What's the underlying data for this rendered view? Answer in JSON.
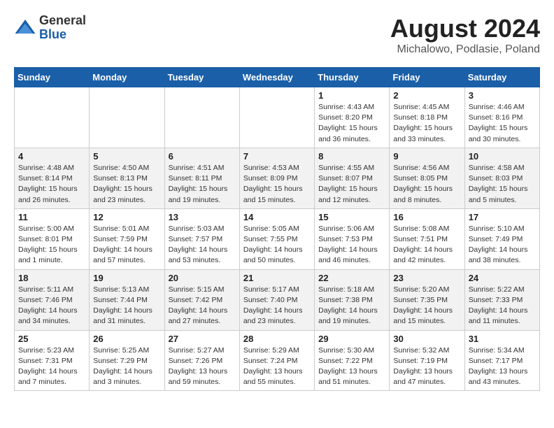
{
  "logo": {
    "general": "General",
    "blue": "Blue"
  },
  "title": {
    "month": "August 2024",
    "location": "Michalowo, Podlasie, Poland"
  },
  "weekdays": [
    "Sunday",
    "Monday",
    "Tuesday",
    "Wednesday",
    "Thursday",
    "Friday",
    "Saturday"
  ],
  "weeks": [
    [
      {
        "day": "",
        "info": ""
      },
      {
        "day": "",
        "info": ""
      },
      {
        "day": "",
        "info": ""
      },
      {
        "day": "",
        "info": ""
      },
      {
        "day": "1",
        "info": "Sunrise: 4:43 AM\nSunset: 8:20 PM\nDaylight: 15 hours\nand 36 minutes."
      },
      {
        "day": "2",
        "info": "Sunrise: 4:45 AM\nSunset: 8:18 PM\nDaylight: 15 hours\nand 33 minutes."
      },
      {
        "day": "3",
        "info": "Sunrise: 4:46 AM\nSunset: 8:16 PM\nDaylight: 15 hours\nand 30 minutes."
      }
    ],
    [
      {
        "day": "4",
        "info": "Sunrise: 4:48 AM\nSunset: 8:14 PM\nDaylight: 15 hours\nand 26 minutes."
      },
      {
        "day": "5",
        "info": "Sunrise: 4:50 AM\nSunset: 8:13 PM\nDaylight: 15 hours\nand 23 minutes."
      },
      {
        "day": "6",
        "info": "Sunrise: 4:51 AM\nSunset: 8:11 PM\nDaylight: 15 hours\nand 19 minutes."
      },
      {
        "day": "7",
        "info": "Sunrise: 4:53 AM\nSunset: 8:09 PM\nDaylight: 15 hours\nand 15 minutes."
      },
      {
        "day": "8",
        "info": "Sunrise: 4:55 AM\nSunset: 8:07 PM\nDaylight: 15 hours\nand 12 minutes."
      },
      {
        "day": "9",
        "info": "Sunrise: 4:56 AM\nSunset: 8:05 PM\nDaylight: 15 hours\nand 8 minutes."
      },
      {
        "day": "10",
        "info": "Sunrise: 4:58 AM\nSunset: 8:03 PM\nDaylight: 15 hours\nand 5 minutes."
      }
    ],
    [
      {
        "day": "11",
        "info": "Sunrise: 5:00 AM\nSunset: 8:01 PM\nDaylight: 15 hours\nand 1 minute."
      },
      {
        "day": "12",
        "info": "Sunrise: 5:01 AM\nSunset: 7:59 PM\nDaylight: 14 hours\nand 57 minutes."
      },
      {
        "day": "13",
        "info": "Sunrise: 5:03 AM\nSunset: 7:57 PM\nDaylight: 14 hours\nand 53 minutes."
      },
      {
        "day": "14",
        "info": "Sunrise: 5:05 AM\nSunset: 7:55 PM\nDaylight: 14 hours\nand 50 minutes."
      },
      {
        "day": "15",
        "info": "Sunrise: 5:06 AM\nSunset: 7:53 PM\nDaylight: 14 hours\nand 46 minutes."
      },
      {
        "day": "16",
        "info": "Sunrise: 5:08 AM\nSunset: 7:51 PM\nDaylight: 14 hours\nand 42 minutes."
      },
      {
        "day": "17",
        "info": "Sunrise: 5:10 AM\nSunset: 7:49 PM\nDaylight: 14 hours\nand 38 minutes."
      }
    ],
    [
      {
        "day": "18",
        "info": "Sunrise: 5:11 AM\nSunset: 7:46 PM\nDaylight: 14 hours\nand 34 minutes."
      },
      {
        "day": "19",
        "info": "Sunrise: 5:13 AM\nSunset: 7:44 PM\nDaylight: 14 hours\nand 31 minutes."
      },
      {
        "day": "20",
        "info": "Sunrise: 5:15 AM\nSunset: 7:42 PM\nDaylight: 14 hours\nand 27 minutes."
      },
      {
        "day": "21",
        "info": "Sunrise: 5:17 AM\nSunset: 7:40 PM\nDaylight: 14 hours\nand 23 minutes."
      },
      {
        "day": "22",
        "info": "Sunrise: 5:18 AM\nSunset: 7:38 PM\nDaylight: 14 hours\nand 19 minutes."
      },
      {
        "day": "23",
        "info": "Sunrise: 5:20 AM\nSunset: 7:35 PM\nDaylight: 14 hours\nand 15 minutes."
      },
      {
        "day": "24",
        "info": "Sunrise: 5:22 AM\nSunset: 7:33 PM\nDaylight: 14 hours\nand 11 minutes."
      }
    ],
    [
      {
        "day": "25",
        "info": "Sunrise: 5:23 AM\nSunset: 7:31 PM\nDaylight: 14 hours\nand 7 minutes."
      },
      {
        "day": "26",
        "info": "Sunrise: 5:25 AM\nSunset: 7:29 PM\nDaylight: 14 hours\nand 3 minutes."
      },
      {
        "day": "27",
        "info": "Sunrise: 5:27 AM\nSunset: 7:26 PM\nDaylight: 13 hours\nand 59 minutes."
      },
      {
        "day": "28",
        "info": "Sunrise: 5:29 AM\nSunset: 7:24 PM\nDaylight: 13 hours\nand 55 minutes."
      },
      {
        "day": "29",
        "info": "Sunrise: 5:30 AM\nSunset: 7:22 PM\nDaylight: 13 hours\nand 51 minutes."
      },
      {
        "day": "30",
        "info": "Sunrise: 5:32 AM\nSunset: 7:19 PM\nDaylight: 13 hours\nand 47 minutes."
      },
      {
        "day": "31",
        "info": "Sunrise: 5:34 AM\nSunset: 7:17 PM\nDaylight: 13 hours\nand 43 minutes."
      }
    ]
  ]
}
